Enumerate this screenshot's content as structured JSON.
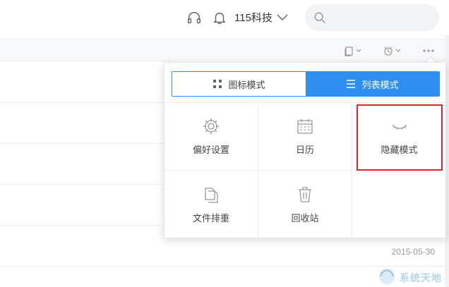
{
  "header": {
    "user_name": "115科技",
    "search": {
      "placeholder": "",
      "value": ""
    },
    "icons": [
      "headset-icon",
      "bell-icon",
      "chevron-down-icon",
      "search-icon"
    ]
  },
  "toolbar": {
    "icons": [
      "copy-icon",
      "clean-icon",
      "more-icon"
    ]
  },
  "file_list": {
    "rows": [
      {
        "date": ""
      },
      {
        "date": ""
      },
      {
        "date": ""
      },
      {
        "date": ""
      },
      {
        "date": "2015-05-30"
      }
    ]
  },
  "view_menu": {
    "mode_toggle": {
      "icon_mode": "图标模式",
      "list_mode": "列表模式",
      "active": "list_mode"
    },
    "items": [
      {
        "label": "偏好设置",
        "icon": "gear-icon"
      },
      {
        "label": "日历",
        "icon": "calendar-icon"
      },
      {
        "label": "隐藏模式",
        "icon": "closed-eye-icon"
      },
      {
        "label": "文件排重",
        "icon": "duplicate-file-icon"
      },
      {
        "label": "回收站",
        "icon": "trash-icon"
      }
    ]
  },
  "watermark": {
    "text": "系统天地"
  },
  "colors": {
    "accent": "#2f8ff0",
    "highlight": "#d9262b",
    "search_bg": "#f1f3f5",
    "toolbar_bg": "#f7f8fa"
  }
}
